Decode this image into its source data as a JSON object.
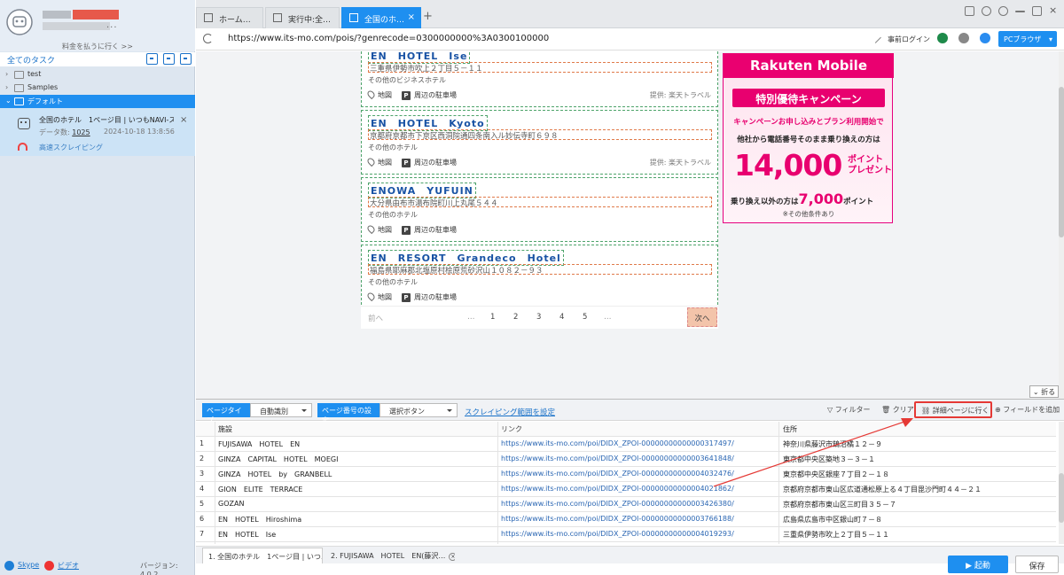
{
  "sidebar": {
    "pay_link": "料金を払うに行く >>",
    "tasks_title": "全てのタスク",
    "tree": [
      {
        "label": "test"
      },
      {
        "label": "Samples"
      },
      {
        "label": "デフォルト"
      }
    ],
    "task": {
      "title": "全国のホテル　1ページ目 | いつもNAVI-ス…",
      "count_label": "データ数:",
      "count": "1025",
      "date": "2024-10-18 13:8:56",
      "fast_label": "高速スクレイピング"
    },
    "skype": "Skype",
    "video": "ビデオ",
    "version": "バージョン: 4.0.2"
  },
  "tabs": [
    {
      "label": "ホーム…"
    },
    {
      "label": "実行中:全…"
    },
    {
      "label": "全国のホ…",
      "active": true
    }
  ],
  "address": {
    "url": "https://www.its-mo.com/pois/?genrecode=0300000000%3A0300100000",
    "login": "事前ログイン",
    "browser": "PCブラウザ"
  },
  "results": [
    {
      "name": "EN　HOTEL　Ise",
      "address": "三重県伊勢市吹上２丁目５－１１",
      "category": "その他のビジネスホテル",
      "map": "地図",
      "parking": "周辺の駐車場",
      "provider": "提供: 楽天トラベル"
    },
    {
      "name": "EN　HOTEL　Kyoto",
      "address": "京都府京都市下京区西洞院通四条南入ル妙伝寺町６９８",
      "category": "その他のホテル",
      "map": "地図",
      "parking": "周辺の駐車場",
      "provider": "提供: 楽天トラベル"
    },
    {
      "name": "ENOWA　YUFUIN",
      "address": "大分県由布市湯布院町川上丸尾５４４",
      "category": "その他のホテル",
      "map": "地図",
      "parking": "周辺の駐車場",
      "provider": ""
    },
    {
      "name": "EN　RESORT　Grandeco　Hotel",
      "address": "福島県耶麻郡北塩原村桧原荒砂沢山１０８２－９３",
      "category": "その他のホテル",
      "map": "地図",
      "parking": "周辺の駐車場",
      "provider": ""
    }
  ],
  "pager": {
    "prev": "前へ",
    "ellipsis": "…",
    "pages": [
      "1",
      "2",
      "3",
      "4",
      "5"
    ],
    "next": "次へ"
  },
  "ad": {
    "brand": "Rakuten Mobile",
    "pill": "特別優待キャンペーン",
    "line1": "キャンペーンお申し込みとプラン利用開始で",
    "line2": "他社から電話番号そのまま乗り換えの方は",
    "big": "14,000",
    "big_unit": "ポイント",
    "big_unit2": "プレゼント",
    "line3_pre": "乗り換え以外の方は",
    "line3_num": "7,000",
    "line3_post": "ポイント",
    "note": "※その他条件あり"
  },
  "fold": "折る",
  "panel": {
    "page_type_tag": "ページタイプ",
    "page_type_value": "自動識別",
    "page_num_tag": "ページ番号の設定",
    "page_num_value": "選択ボタン",
    "range_link": "スクレイピング範囲を設定",
    "filter": "フィルター",
    "clear": "クリア",
    "detail": "詳細ページに行く",
    "add_field": "フィールドを追加",
    "columns": [
      "施設",
      "リンク",
      "住所"
    ],
    "rows": [
      [
        "1",
        "FUJISAWA　HOTEL　EN",
        "https://www.its-mo.com/poi/DIDX_ZPOI-00000000000000317497/",
        "神奈川県藤沢市鵠沼橘１２－９"
      ],
      [
        "2",
        "GINZA　CAPITAL　HOTEL　MOEGI",
        "https://www.its-mo.com/poi/DIDX_ZPOI-00000000000003641848/",
        "東京都中央区築地３－３－１"
      ],
      [
        "3",
        "GINZA　HOTEL　by　GRANBELL",
        "https://www.its-mo.com/poi/DIDX_ZPOI-00000000000004032476/",
        "東京都中央区銀座７丁目２－１８"
      ],
      [
        "4",
        "GION　ELITE　TERRACE",
        "https://www.its-mo.com/poi/DIDX_ZPOI-00000000000004021862/",
        "京都府京都市東山区広道通松原上る４丁目毘沙門町４４－２１"
      ],
      [
        "5",
        "GOZAN",
        "https://www.its-mo.com/poi/DIDX_ZPOI-00000000000003426380/",
        "京都府京都市東山区三町目３５－７"
      ],
      [
        "6",
        "EN　HOTEL　Hiroshima",
        "https://www.its-mo.com/poi/DIDX_ZPOI-00000000000003766188/",
        "広島県広島市中区銀山町７－８"
      ],
      [
        "7",
        "EN　HOTEL　Ise",
        "https://www.its-mo.com/poi/DIDX_ZPOI-00000000000004019293/",
        "三重県伊勢市吹上２丁目５－１１"
      ]
    ],
    "bottom_tabs": [
      "1. 全国のホテル　1ページ目 | いつ…",
      "2. FUJISAWA　HOTEL　EN(藤沢…"
    ],
    "run": "▶ 起動",
    "save": "保存"
  },
  "colors": {
    "accent": "#1e8ff0",
    "highlight": "#e53935",
    "rakuten": "#e8006f"
  }
}
